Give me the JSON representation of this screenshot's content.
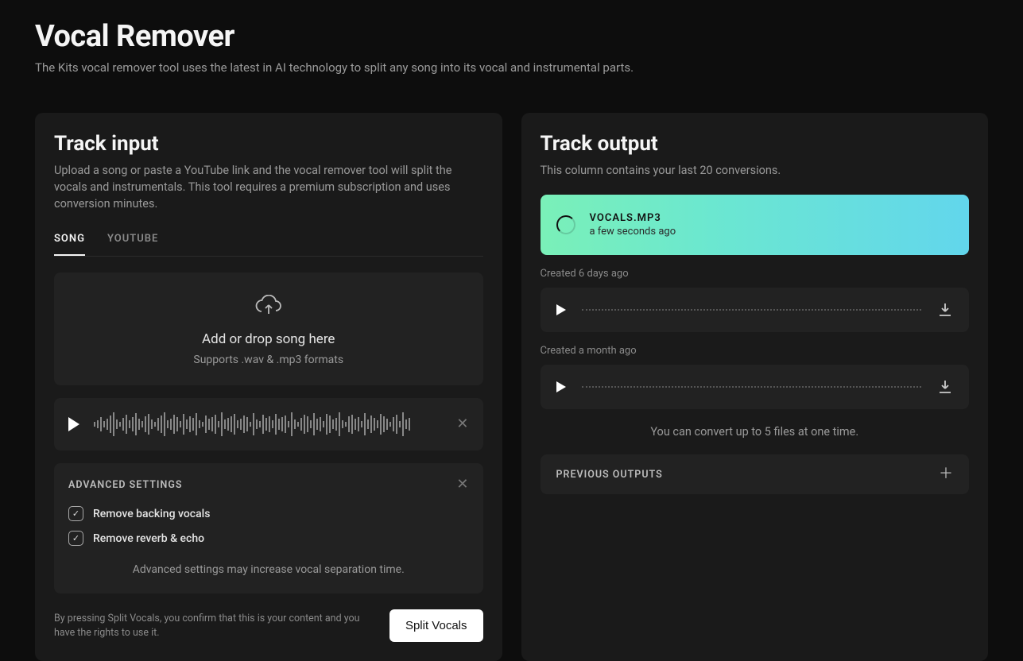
{
  "header": {
    "title": "Vocal Remover",
    "subtitle": "The Kits vocal remover tool uses the latest in AI technology to split any song into its vocal and instrumental parts."
  },
  "input": {
    "title": "Track input",
    "subtitle": "Upload a song or paste a YouTube link and the vocal remover tool will split the vocals and instrumentals. This tool requires a premium subscription and uses conversion minutes.",
    "tabs": {
      "song": "SONG",
      "youtube": "YOUTUBE"
    },
    "dropzone": {
      "text": "Add or drop song here",
      "sub": "Supports .wav & .mp3 formats"
    },
    "advanced": {
      "title": "ADVANCED SETTINGS",
      "opt1": "Remove backing vocals",
      "opt2": "Remove reverb & echo",
      "note": "Advanced settings may increase vocal separation time."
    },
    "disclaimer": "By pressing Split Vocals, you confirm that this is your content and you have the rights to use it.",
    "split_btn": "Split Vocals"
  },
  "output": {
    "title": "Track output",
    "subtitle": "This column contains your last 20 conversions.",
    "processing": {
      "filename": "VOCALS.MP3",
      "time": "a few seconds ago"
    },
    "items": [
      {
        "created": "Created 6 days ago"
      },
      {
        "created": "Created a month ago"
      }
    ],
    "limit_note": "You can convert up to 5 files at one time.",
    "previous": "PREVIOUS OUTPUTS"
  }
}
